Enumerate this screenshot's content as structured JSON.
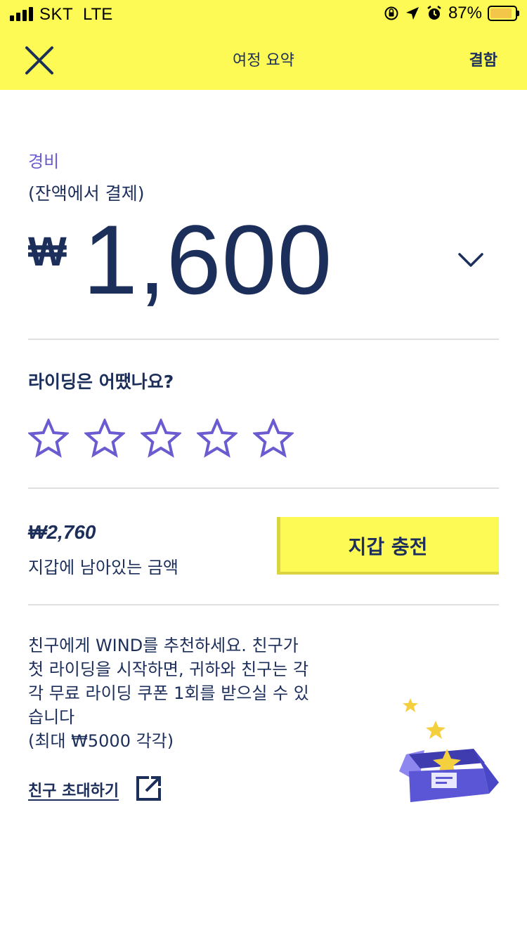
{
  "status_bar": {
    "carrier": "SKT",
    "network": "LTE",
    "battery_percent": "87%",
    "battery_level": 0.87
  },
  "nav": {
    "title": "여정 요약",
    "action": "결함",
    "close_icon": "close-icon"
  },
  "fee": {
    "label": "경비",
    "sublabel": "(잔액에서 결제)",
    "currency_symbol": "₩",
    "amount": "1,600",
    "expand_icon": "chevron-down-icon"
  },
  "rating": {
    "question": "라이딩은 어땠나요?",
    "stars_total": 5,
    "stars_selected": 0
  },
  "wallet": {
    "amount": "₩2,760",
    "description": "지갑에 남아있는 금액",
    "topup_label": "지갑 충전"
  },
  "referral": {
    "lines": [
      "친구에게 WIND를 추천하세요. 친구가",
      "첫 라이딩을 시작하면, 귀하와 친구는 각",
      "각 무료 라이딩 쿠폰 1회를 받으실 수 있",
      "습니다",
      "(최대 ₩5000 각각)"
    ],
    "invite_label": "친구 초대하기",
    "invite_icon": "external-link-icon",
    "illustration": "gift-box-stars"
  },
  "colors": {
    "accent_yellow": "#fefa55",
    "navy": "#1c2e5a",
    "purple": "#6b5bd1"
  }
}
